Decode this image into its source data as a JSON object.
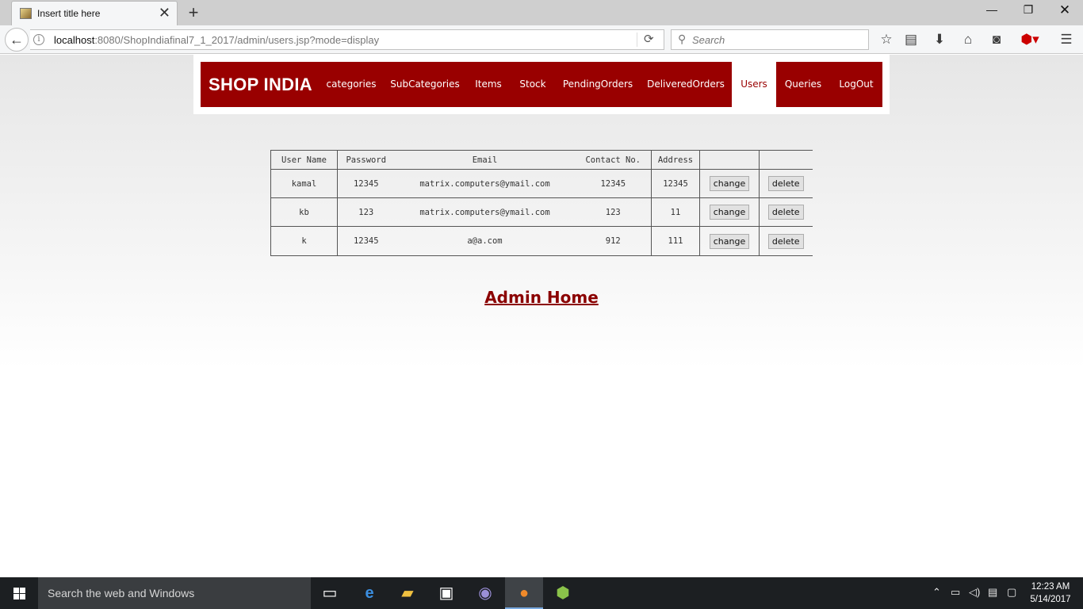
{
  "browser": {
    "tab_title": "Insert title here",
    "tab_close": "✕",
    "new_tab": "+",
    "window_min": "—",
    "window_max": "❐",
    "window_close": "✕",
    "back_glyph": "←",
    "url_host": "localhost",
    "url_rest": ":8080/ShopIndiafinal7_1_2017/admin/users.jsp?mode=display",
    "search_placeholder": "Search",
    "toolbar_icons": [
      "bookmark-star-icon",
      "reading-list-icon",
      "download-icon",
      "home-icon",
      "pocket-icon",
      "adblock-icon",
      "menu-icon"
    ]
  },
  "site": {
    "logo": "SHOP INDIA",
    "nav": [
      {
        "label": "categories",
        "active": false
      },
      {
        "label": "SubCategories",
        "active": false
      },
      {
        "label": "Items",
        "active": false
      },
      {
        "label": "Stock",
        "active": false
      },
      {
        "label": "PendingOrders",
        "active": false
      },
      {
        "label": "DeliveredOrders",
        "active": false
      },
      {
        "label": "Users",
        "active": true
      },
      {
        "label": "Queries",
        "active": false
      },
      {
        "label": "LogOut",
        "active": false
      }
    ],
    "brand_color": "#990000"
  },
  "users_table": {
    "headers": [
      "User Name",
      "Password",
      "Email",
      "Contact No.",
      "Address",
      "",
      ""
    ],
    "rows": [
      {
        "username": "kamal",
        "password": "12345",
        "email": "matrix.computers@ymail.com",
        "contact": "12345",
        "address": "12345",
        "change_label": "change",
        "delete_label": "delete"
      },
      {
        "username": "kb",
        "password": "123",
        "email": "matrix.computers@ymail.com",
        "contact": "123",
        "address": "11",
        "change_label": "change",
        "delete_label": "delete"
      },
      {
        "username": "k",
        "password": "12345",
        "email": "a@a.com",
        "contact": "912",
        "address": "111",
        "change_label": "change",
        "delete_label": "delete"
      }
    ]
  },
  "admin_home_link": "Admin Home",
  "taskbar": {
    "search_text": "Search the web and Windows",
    "apps": [
      "task-view-icon",
      "edge-icon",
      "file-explorer-icon",
      "store-icon",
      "eclipse-icon",
      "firefox-icon",
      "android-studio-icon"
    ],
    "active_app": "firefox-icon",
    "time": "12:23 AM",
    "date": "5/14/2017"
  }
}
